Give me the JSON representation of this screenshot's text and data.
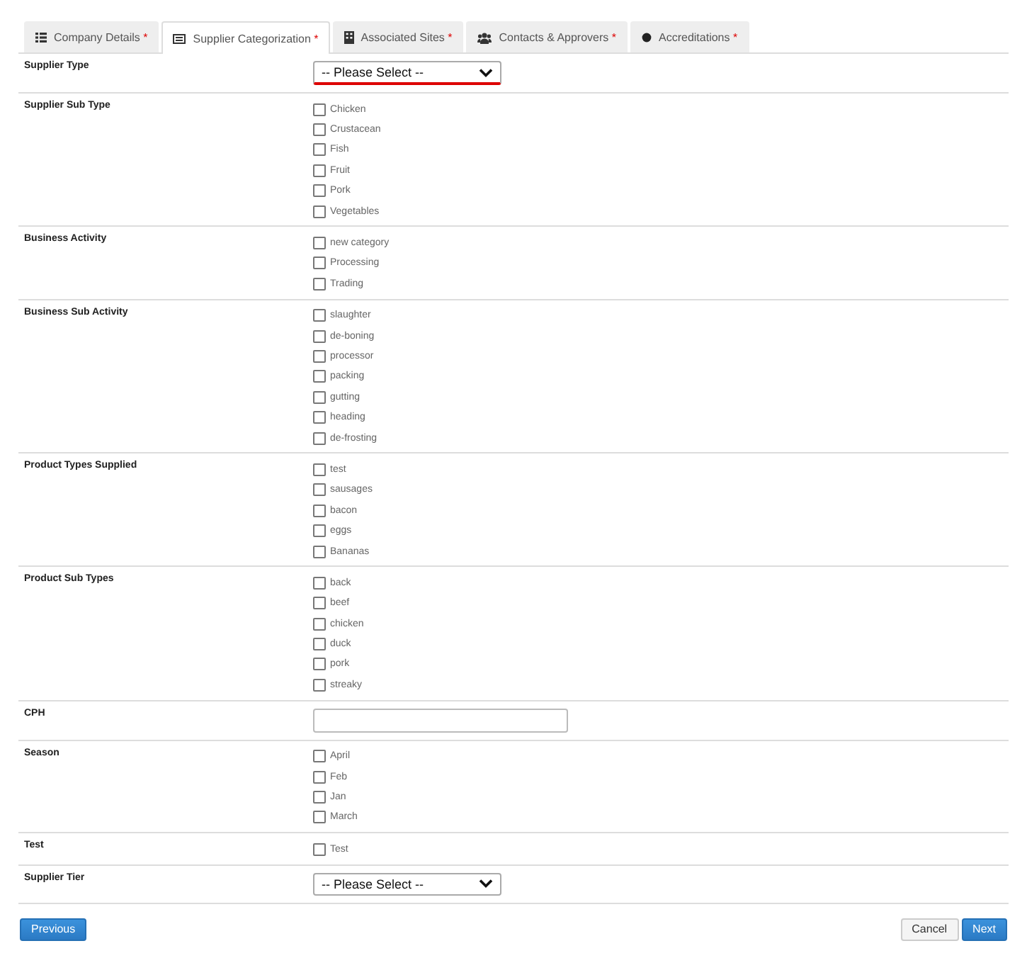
{
  "tabs": [
    {
      "label": "Company Details",
      "kind": "list",
      "required": "*",
      "selected": false
    },
    {
      "label": "Supplier Categorization",
      "kind": "card",
      "required": "*",
      "selected": true
    },
    {
      "label": "Associated Sites",
      "kind": "building",
      "required": "*",
      "selected": false
    },
    {
      "label": "Contacts & Approvers",
      "kind": "users",
      "required": "*",
      "selected": false
    },
    {
      "label": "Accreditations",
      "kind": "dot",
      "required": "*",
      "selected": false
    }
  ],
  "fields": [
    {
      "label": "Supplier Type",
      "kind": "select",
      "value": "-- Please Select --",
      "invalid": true
    },
    {
      "label": "Supplier Sub Type",
      "kind": "checkboxes",
      "options": [
        {
          "label": "Chicken",
          "checked": false
        },
        {
          "label": "Crustacean",
          "checked": false
        },
        {
          "label": "Fish",
          "checked": false
        },
        {
          "label": "Fruit",
          "checked": false
        },
        {
          "label": "Pork",
          "checked": false
        },
        {
          "label": "Vegetables",
          "checked": false
        }
      ]
    },
    {
      "label": "Business Activity",
      "kind": "checkboxes",
      "options": [
        {
          "label": "new category",
          "checked": false
        },
        {
          "label": "Processing",
          "checked": false
        },
        {
          "label": "Trading",
          "checked": false
        }
      ]
    },
    {
      "label": "Business Sub Activity",
      "kind": "checkboxes",
      "options": [
        {
          "label": "slaughter",
          "checked": false
        },
        {
          "label": "de-boning",
          "checked": false
        },
        {
          "label": "processor",
          "checked": false
        },
        {
          "label": "packing",
          "checked": false
        },
        {
          "label": "gutting",
          "checked": false
        },
        {
          "label": "heading",
          "checked": false
        },
        {
          "label": "de-frosting",
          "checked": false
        }
      ]
    },
    {
      "label": "Product Types Supplied",
      "kind": "checkboxes",
      "options": [
        {
          "label": "test",
          "checked": false
        },
        {
          "label": "sausages",
          "checked": false
        },
        {
          "label": "bacon",
          "checked": false
        },
        {
          "label": "eggs",
          "checked": false
        },
        {
          "label": "Bananas",
          "checked": false
        }
      ]
    },
    {
      "label": "Product Sub Types",
      "kind": "checkboxes",
      "options": [
        {
          "label": "back",
          "checked": false
        },
        {
          "label": "beef",
          "checked": false
        },
        {
          "label": "chicken",
          "checked": false
        },
        {
          "label": "duck",
          "checked": false
        },
        {
          "label": "pork",
          "checked": false
        },
        {
          "label": "streaky",
          "checked": false
        }
      ]
    },
    {
      "label": "CPH",
      "kind": "text"
    },
    {
      "label": "Season",
      "kind": "checkboxes",
      "options": [
        {
          "label": "April",
          "checked": false
        },
        {
          "label": "Feb",
          "checked": false
        },
        {
          "label": "Jan",
          "checked": false
        },
        {
          "label": "March",
          "checked": false
        }
      ]
    },
    {
      "label": "Test",
      "kind": "checkboxes",
      "options": [
        {
          "label": "Test",
          "checked": false
        }
      ]
    },
    {
      "label": "Supplier Tier",
      "kind": "select",
      "value": "-- Please Select --",
      "invalid": false
    }
  ],
  "buttons": {
    "previous": "Previous",
    "cancel": "Cancel",
    "next": "Next"
  }
}
